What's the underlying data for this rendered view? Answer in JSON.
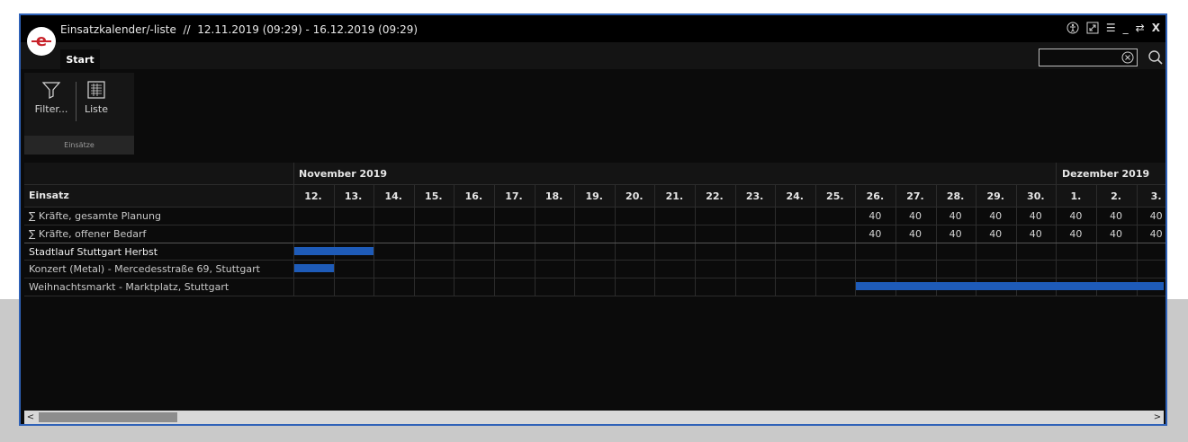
{
  "window": {
    "title": "Einsatzkalender/-liste  //  12.11.2019 (09:29) - 16.12.2019 (09:29)",
    "controls": [
      "☰",
      "_",
      "⇄",
      "X"
    ],
    "accent": "#2f62b8"
  },
  "tabs": [
    {
      "label": "Start",
      "active": true
    }
  ],
  "search": {
    "value": "",
    "placeholder": ""
  },
  "ribbon": {
    "buttons": [
      {
        "label": "Filter...",
        "icon": "filter-icon"
      },
      {
        "label": "Liste",
        "icon": "list-icon"
      }
    ],
    "group_label": "Einsätze"
  },
  "calendar": {
    "column_header": "Einsatz",
    "months": [
      "November 2019",
      "Dezember 2019"
    ],
    "days": [
      "12.",
      "13.",
      "14.",
      "15.",
      "16.",
      "17.",
      "18.",
      "19.",
      "20.",
      "21.",
      "22.",
      "23.",
      "24.",
      "25.",
      "26.",
      "27.",
      "28.",
      "29.",
      "30.",
      "1.",
      "2.",
      "3."
    ],
    "rows": [
      {
        "label": "∑ Kräfte, gesamte Planung",
        "values": [
          "",
          "",
          "",
          "",
          "",
          "",
          "",
          "",
          "",
          "",
          "",
          "",
          "",
          "",
          "40",
          "40",
          "40",
          "40",
          "40",
          "40",
          "40",
          "40"
        ]
      },
      {
        "label": "∑ Kräfte, offener Bedarf",
        "values": [
          "",
          "",
          "",
          "",
          "",
          "",
          "",
          "",
          "",
          "",
          "",
          "",
          "",
          "",
          "40",
          "40",
          "40",
          "40",
          "40",
          "40",
          "40",
          "40"
        ]
      },
      {
        "label": "Stadtlauf Stuttgart Herbst",
        "bar": {
          "start_day": "12.",
          "end_day": "13."
        }
      },
      {
        "label": "Konzert (Metal) - Mercedesstraße 69, Stuttgart",
        "bar": {
          "start_day": "12.",
          "end_day": "12."
        }
      },
      {
        "label": "Weihnachtsmarkt - Marktplatz, Stuttgart",
        "bar": {
          "start_day": "26.",
          "end_day": "3."
        }
      }
    ],
    "bar_color": "#1e5bb8"
  },
  "scrollbar": {
    "left_arrow": "<",
    "right_arrow": ">"
  }
}
